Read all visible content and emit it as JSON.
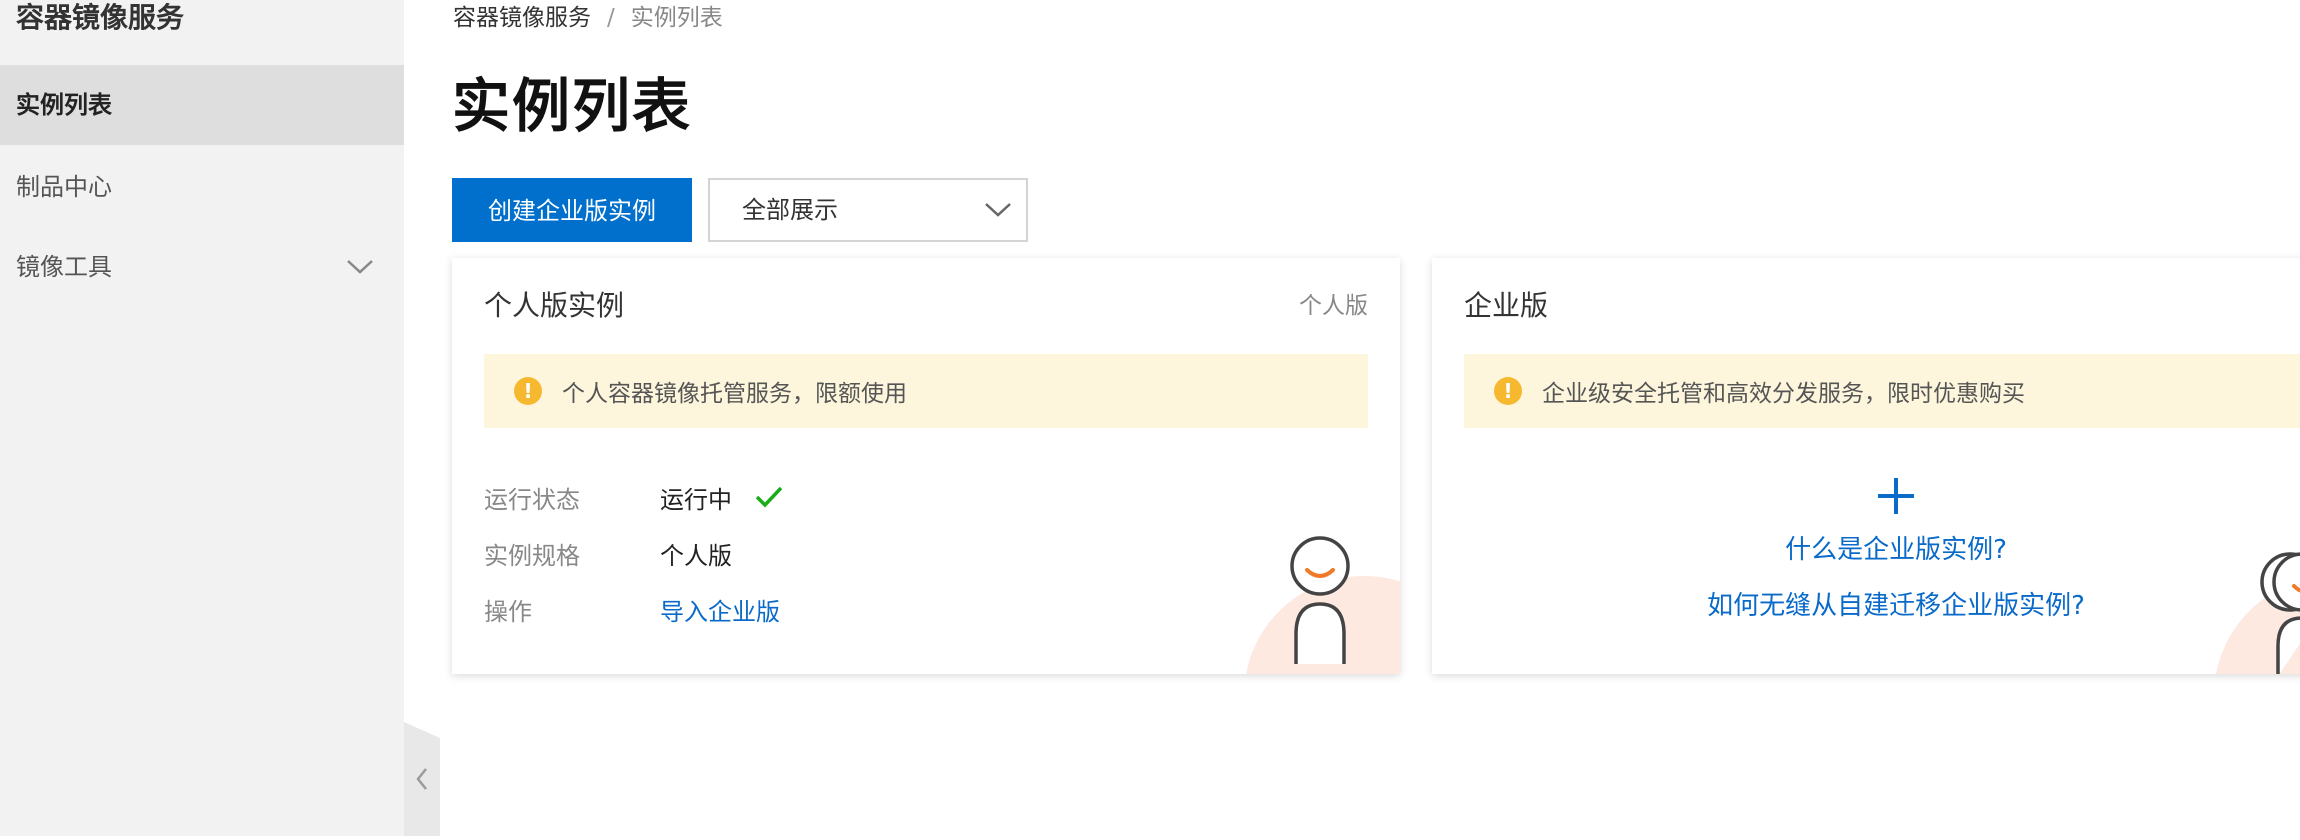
{
  "sidebar": {
    "title": "容器镜像服务",
    "items": [
      {
        "label": "实例列表",
        "active": true
      },
      {
        "label": "制品中心",
        "active": false
      },
      {
        "label": "镜像工具",
        "active": false,
        "expandable": true,
        "icon": "chevron-down-icon"
      }
    ]
  },
  "breadcrumb": {
    "items": [
      "容器镜像服务",
      "实例列表"
    ],
    "separator": "/"
  },
  "page": {
    "title": "实例列表"
  },
  "toolbar": {
    "create_label": "创建企业版实例",
    "filter_value": "全部展示"
  },
  "personal_card": {
    "title": "个人版实例",
    "tag": "个人版",
    "notice": "个人容器镜像托管服务，限额使用",
    "rows": [
      {
        "label": "运行状态",
        "value": "运行中"
      },
      {
        "label": "实例规格",
        "value": "个人版"
      },
      {
        "label": "操作",
        "value": "导入企业版"
      }
    ]
  },
  "enterprise_card": {
    "title": "企业版",
    "notice": "企业级安全托管和高效分发服务，限时优惠购买",
    "links": [
      "什么是企业版实例?",
      "如何无缝从自建迁移企业版实例?"
    ]
  },
  "colors": {
    "primary": "#0070cc",
    "link": "#0a6ac9",
    "warning": "#f5b82e",
    "notice_bg": "#fdf6dd",
    "success": "#1aad19",
    "smile": "#f07a2a"
  }
}
